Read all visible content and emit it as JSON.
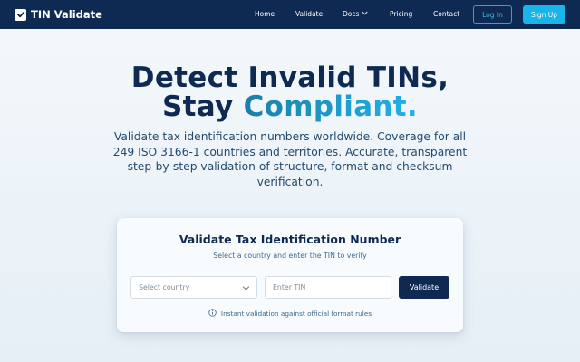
{
  "brand": {
    "name": "TIN Validate",
    "icon": "check-square-icon"
  },
  "nav": {
    "links": [
      "Home",
      "Validate",
      "Docs",
      "Pricing",
      "Contact"
    ],
    "login_label": "Log In",
    "signup_label": "Sign Up"
  },
  "hero": {
    "title_line1": "Detect Invalid TINs,",
    "title_line2_plain": "Stay ",
    "title_line2_accent": "Compliant.",
    "subtitle": "Validate tax identification numbers worldwide. Coverage for all 249 ISO 3166-1 countries and territories. Accurate, transparent step-by-step validation of structure, format and checksum verification."
  },
  "card": {
    "title": "Validate Tax Identification Number",
    "subtitle": "Select a country and enter the TIN to verify",
    "country_placeholder": "Select country",
    "tin_placeholder": "Enter TIN",
    "validate_label": "Validate",
    "note": "Instant validation against official format rules",
    "note_icon": "info-circle-icon"
  },
  "colors": {
    "navy": "#0e2a52",
    "accent": "#19b4ea",
    "accent_gradient_start": "#1a7fa8"
  }
}
